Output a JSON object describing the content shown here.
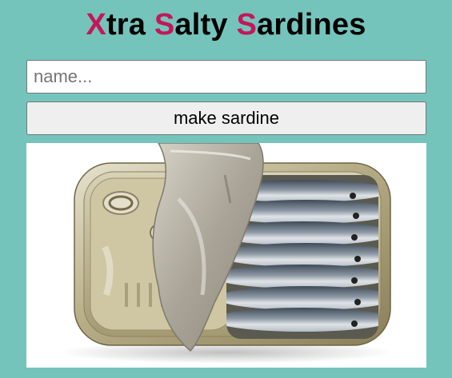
{
  "title": {
    "parts": [
      {
        "text": "X",
        "accent": true
      },
      {
        "text": "tra ",
        "accent": false
      },
      {
        "text": "S",
        "accent": true
      },
      {
        "text": "alty ",
        "accent": false
      },
      {
        "text": "S",
        "accent": true
      },
      {
        "text": "ardines",
        "accent": false
      }
    ],
    "accent_color": "#c4175a"
  },
  "name_input": {
    "value": "",
    "placeholder": "name..."
  },
  "make_button": {
    "label": "make sardine"
  },
  "image": {
    "icon": "sardine-can-image"
  },
  "colors": {
    "background": "#75c4bb",
    "accent": "#c4175a"
  }
}
